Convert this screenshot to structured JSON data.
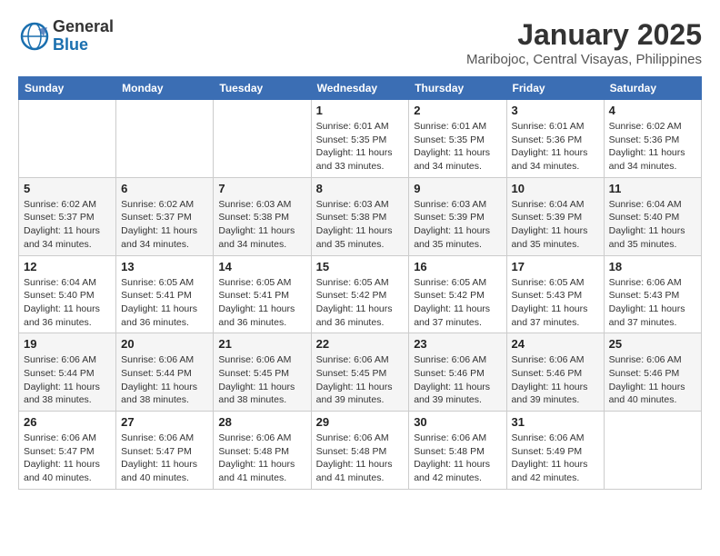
{
  "header": {
    "logo_line1": "General",
    "logo_line2": "Blue",
    "month": "January 2025",
    "location": "Maribojoc, Central Visayas, Philippines"
  },
  "weekdays": [
    "Sunday",
    "Monday",
    "Tuesday",
    "Wednesday",
    "Thursday",
    "Friday",
    "Saturday"
  ],
  "weeks": [
    [
      {
        "day": "",
        "info": ""
      },
      {
        "day": "",
        "info": ""
      },
      {
        "day": "",
        "info": ""
      },
      {
        "day": "1",
        "info": "Sunrise: 6:01 AM\nSunset: 5:35 PM\nDaylight: 11 hours\nand 33 minutes."
      },
      {
        "day": "2",
        "info": "Sunrise: 6:01 AM\nSunset: 5:35 PM\nDaylight: 11 hours\nand 34 minutes."
      },
      {
        "day": "3",
        "info": "Sunrise: 6:01 AM\nSunset: 5:36 PM\nDaylight: 11 hours\nand 34 minutes."
      },
      {
        "day": "4",
        "info": "Sunrise: 6:02 AM\nSunset: 5:36 PM\nDaylight: 11 hours\nand 34 minutes."
      }
    ],
    [
      {
        "day": "5",
        "info": "Sunrise: 6:02 AM\nSunset: 5:37 PM\nDaylight: 11 hours\nand 34 minutes."
      },
      {
        "day": "6",
        "info": "Sunrise: 6:02 AM\nSunset: 5:37 PM\nDaylight: 11 hours\nand 34 minutes."
      },
      {
        "day": "7",
        "info": "Sunrise: 6:03 AM\nSunset: 5:38 PM\nDaylight: 11 hours\nand 34 minutes."
      },
      {
        "day": "8",
        "info": "Sunrise: 6:03 AM\nSunset: 5:38 PM\nDaylight: 11 hours\nand 35 minutes."
      },
      {
        "day": "9",
        "info": "Sunrise: 6:03 AM\nSunset: 5:39 PM\nDaylight: 11 hours\nand 35 minutes."
      },
      {
        "day": "10",
        "info": "Sunrise: 6:04 AM\nSunset: 5:39 PM\nDaylight: 11 hours\nand 35 minutes."
      },
      {
        "day": "11",
        "info": "Sunrise: 6:04 AM\nSunset: 5:40 PM\nDaylight: 11 hours\nand 35 minutes."
      }
    ],
    [
      {
        "day": "12",
        "info": "Sunrise: 6:04 AM\nSunset: 5:40 PM\nDaylight: 11 hours\nand 36 minutes."
      },
      {
        "day": "13",
        "info": "Sunrise: 6:05 AM\nSunset: 5:41 PM\nDaylight: 11 hours\nand 36 minutes."
      },
      {
        "day": "14",
        "info": "Sunrise: 6:05 AM\nSunset: 5:41 PM\nDaylight: 11 hours\nand 36 minutes."
      },
      {
        "day": "15",
        "info": "Sunrise: 6:05 AM\nSunset: 5:42 PM\nDaylight: 11 hours\nand 36 minutes."
      },
      {
        "day": "16",
        "info": "Sunrise: 6:05 AM\nSunset: 5:42 PM\nDaylight: 11 hours\nand 37 minutes."
      },
      {
        "day": "17",
        "info": "Sunrise: 6:05 AM\nSunset: 5:43 PM\nDaylight: 11 hours\nand 37 minutes."
      },
      {
        "day": "18",
        "info": "Sunrise: 6:06 AM\nSunset: 5:43 PM\nDaylight: 11 hours\nand 37 minutes."
      }
    ],
    [
      {
        "day": "19",
        "info": "Sunrise: 6:06 AM\nSunset: 5:44 PM\nDaylight: 11 hours\nand 38 minutes."
      },
      {
        "day": "20",
        "info": "Sunrise: 6:06 AM\nSunset: 5:44 PM\nDaylight: 11 hours\nand 38 minutes."
      },
      {
        "day": "21",
        "info": "Sunrise: 6:06 AM\nSunset: 5:45 PM\nDaylight: 11 hours\nand 38 minutes."
      },
      {
        "day": "22",
        "info": "Sunrise: 6:06 AM\nSunset: 5:45 PM\nDaylight: 11 hours\nand 39 minutes."
      },
      {
        "day": "23",
        "info": "Sunrise: 6:06 AM\nSunset: 5:46 PM\nDaylight: 11 hours\nand 39 minutes."
      },
      {
        "day": "24",
        "info": "Sunrise: 6:06 AM\nSunset: 5:46 PM\nDaylight: 11 hours\nand 39 minutes."
      },
      {
        "day": "25",
        "info": "Sunrise: 6:06 AM\nSunset: 5:46 PM\nDaylight: 11 hours\nand 40 minutes."
      }
    ],
    [
      {
        "day": "26",
        "info": "Sunrise: 6:06 AM\nSunset: 5:47 PM\nDaylight: 11 hours\nand 40 minutes."
      },
      {
        "day": "27",
        "info": "Sunrise: 6:06 AM\nSunset: 5:47 PM\nDaylight: 11 hours\nand 40 minutes."
      },
      {
        "day": "28",
        "info": "Sunrise: 6:06 AM\nSunset: 5:48 PM\nDaylight: 11 hours\nand 41 minutes."
      },
      {
        "day": "29",
        "info": "Sunrise: 6:06 AM\nSunset: 5:48 PM\nDaylight: 11 hours\nand 41 minutes."
      },
      {
        "day": "30",
        "info": "Sunrise: 6:06 AM\nSunset: 5:48 PM\nDaylight: 11 hours\nand 42 minutes."
      },
      {
        "day": "31",
        "info": "Sunrise: 6:06 AM\nSunset: 5:49 PM\nDaylight: 11 hours\nand 42 minutes."
      },
      {
        "day": "",
        "info": ""
      }
    ]
  ]
}
